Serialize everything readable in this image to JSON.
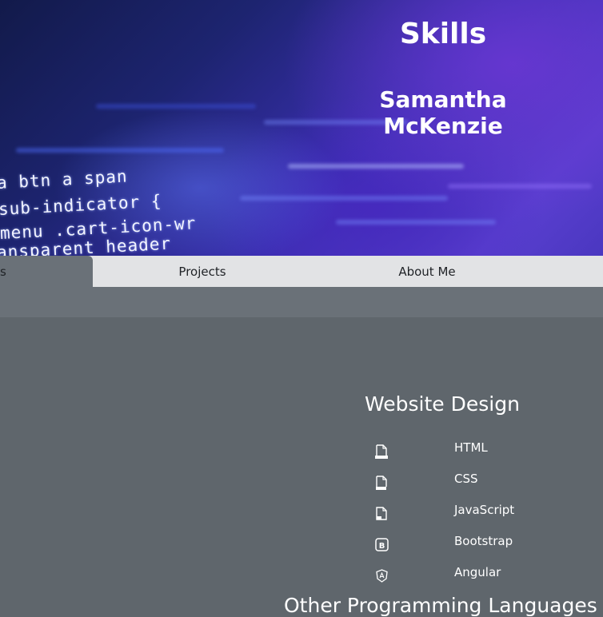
{
  "hero": {
    "title": "Skills",
    "name": "Samantha McKenzie",
    "code_lines": [
      "a btn a span",
      "sub-indicator {",
      "menu .cart-icon-wr",
      "ansparent header"
    ]
  },
  "nav": {
    "tabs": [
      {
        "label": "s",
        "active": true
      },
      {
        "label": "Projects",
        "active": false
      },
      {
        "label": "About Me",
        "active": false
      }
    ]
  },
  "website_design": {
    "title": "Website Design",
    "skills": [
      {
        "label": "HTML",
        "icon": "file-html-icon"
      },
      {
        "label": "CSS",
        "icon": "file-css-icon"
      },
      {
        "label": "JavaScript",
        "icon": "file-js-icon"
      },
      {
        "label": "Bootstrap",
        "icon": "bootstrap-icon"
      },
      {
        "label": "Angular",
        "icon": "angular-icon"
      }
    ]
  },
  "next_section": {
    "title": "Other Programming Languages"
  },
  "colors": {
    "nav_bg": "#e2e3e5",
    "active_tab_bg": "#6a7178",
    "content_bg": "#5f666c",
    "text": "#ffffff"
  }
}
